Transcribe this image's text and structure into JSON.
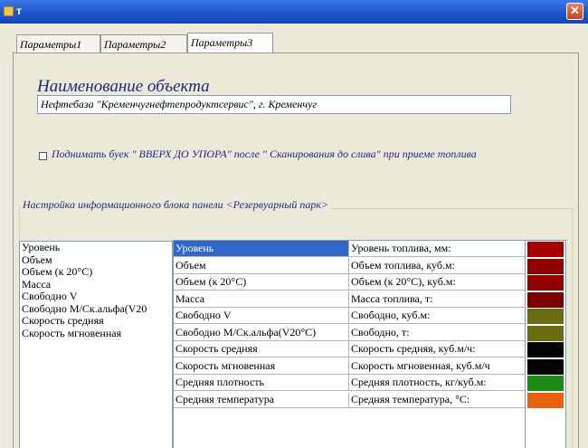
{
  "window": {
    "title": "т"
  },
  "tabs": [
    {
      "label": "Параметры1",
      "active": false
    },
    {
      "label": "Параметры2",
      "active": false
    },
    {
      "label": "Параметры3",
      "active": true
    }
  ],
  "object": {
    "title": "Наименование объекта",
    "value": "Нефтебаза \"Кременчугнефтепродуктсервис\", г. Кременчуг"
  },
  "option": {
    "checked": false,
    "label": "Поднимать буек \" ВВЕРХ ДО УПОРА\" после \" Сканирования до слива\" при приеме топлива"
  },
  "group": {
    "legend": "Настройка информационного блока панели <Резервуарный парк>"
  },
  "left_list": [
    "Уровень",
    "Объем",
    "Объем (к 20°С)",
    "Масса",
    "Свободно V",
    "Свободно М/Ск.альфа(V20",
    "Скорость средняя",
    "Скорость мгновенная"
  ],
  "grid_rows": [
    {
      "name": "Уровень",
      "caption": "Уровень топлива, мм:",
      "color": "#a40000",
      "selected": true
    },
    {
      "name": "Объем",
      "caption": "Объем топлива, куб.м:",
      "color": "#8c0000",
      "selected": false
    },
    {
      "name": "Объем (к 20°С)",
      "caption": "Объем (к 20°С), куб.м:",
      "color": "#8c0000",
      "selected": false
    },
    {
      "name": "Масса",
      "caption": "Масса топлива, т:",
      "color": "#7a0000",
      "selected": false
    },
    {
      "name": "Свободно V",
      "caption": "Свободно, куб.м:",
      "color": "#6b6b12",
      "selected": false
    },
    {
      "name": "Свободно М/Ск.альфа(V20°С)",
      "caption": "Свободно, т:",
      "color": "#6b6b12",
      "selected": false
    },
    {
      "name": "Скорость средняя",
      "caption": "Скорость средняя, куб.м/ч:",
      "color": "#050505",
      "selected": false
    },
    {
      "name": "Скорость мгновенная",
      "caption": "Скорость мгновенная, куб.м/ч",
      "color": "#050505",
      "selected": false
    },
    {
      "name": "Средняя плотность",
      "caption": "Средняя плотность, кг/куб.м:",
      "color": "#1d8a14",
      "selected": false
    },
    {
      "name": "Средняя температура",
      "caption": "Средняя температура, °С:",
      "color": "#e8610c",
      "selected": false
    }
  ]
}
